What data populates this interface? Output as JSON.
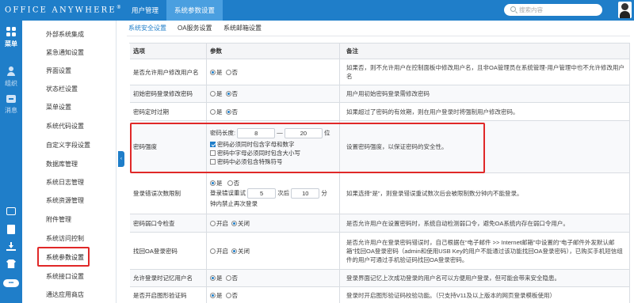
{
  "header": {
    "logo": "Office Anywhere",
    "logo_mark": "®",
    "tabs": [
      "用户管理",
      "系统参数设置"
    ],
    "search_placeholder": "搜索内容"
  },
  "rail": {
    "items": [
      {
        "label": "菜单",
        "icon": "apps-icon"
      },
      {
        "label": "组织",
        "icon": "person-icon"
      },
      {
        "label": "消息",
        "icon": "message-icon"
      }
    ],
    "bottom_pill": "•••"
  },
  "sidebar": {
    "items": [
      "外部系统集成",
      "紧急通知设置",
      "界面设置",
      "状态栏设置",
      "菜单设置",
      "系统代码设置",
      "自定义字段设置",
      "数据库管理",
      "系统日志管理",
      "系统资源管理",
      "附件管理",
      "系统访问控制",
      "系统参数设置",
      "系统接口设置",
      "通达应用商店"
    ],
    "selected": "系统参数设置"
  },
  "subtabs": [
    "系统安全设置",
    "OA服务设置",
    "系统邮箱设置"
  ],
  "table": {
    "headers": [
      "选项",
      "参数",
      "备注"
    ],
    "rows": [
      {
        "option": "是否允许用户修改用户名",
        "yes": "是",
        "no": "否",
        "note": "如果否，则不允许用户在控制面板中修改用户名，且非OA管理员在系统管理-用户管理中也不允许修改用户名"
      },
      {
        "option": "初始密码登录修改密码",
        "yes": "是",
        "no": "否",
        "note": "用户用初始密码登录需修改密码"
      },
      {
        "option": "密码定时过期",
        "yes": "是",
        "no": "否",
        "note": "如果超过了密码的有效期，则在用户登录时将强制用户修改密码。"
      },
      {
        "option": "密码强度",
        "len_label": "密码长度:",
        "len_min": "8",
        "len_sep": "—",
        "len_max": "20",
        "len_unit": "位",
        "checks": [
          "密码必须同时包含字母和数字",
          "密码中字母必须同时包含大小写",
          "密码中必须包含特殊符号"
        ],
        "note": "设置密码强度，以保证密码的安全性。"
      },
      {
        "option": "登录错误次数限制",
        "yes": "是",
        "no": "否",
        "limit_a": "登录错误重试",
        "limit_n1": "5",
        "limit_b": "次后",
        "limit_n2": "10",
        "limit_c": "分",
        "limit_d": "钟内禁止再次登录",
        "note": "如果选择“是”，则登录错误重试数次后会被限制数分钟内不能登录。"
      },
      {
        "option": "密码弱口令检查",
        "on": "开启",
        "off": "关闭",
        "note": "是否允许用户在设置密码时，系统自动检测弱口令，避免OA系统内存在弱口令用户。"
      },
      {
        "option": "找回OA登录密码",
        "on": "开启",
        "off": "关闭",
        "note": "是否允许用户在登录密码错误时，自己根据在“电子邮件 >> Internet邮箱”中设置的“电子邮件外发默认邮箱”找回OA登录密码（admin和使用USB Key的用户不能通过该功能找回OA登录密码），已购买手机短信组件的用户可通过手机验证码找回OA登录密码。"
      },
      {
        "option": "允许登录时记忆用户名",
        "yes": "是",
        "no": "否",
        "note": "登录界面记忆上次成功登录的用户名可以方便用户登录，但可能会带来安全隐患。"
      },
      {
        "option": "是否开启图形验证码",
        "yes": "是",
        "no": "否",
        "note": "登录时开启图形验证码校验功能。（只支持V11及以上版本的网页登录模板使用）"
      }
    ]
  }
}
